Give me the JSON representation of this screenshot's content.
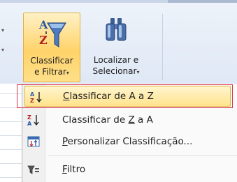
{
  "ribbon": {
    "sort_filter": {
      "line1": "Classificar",
      "line2": "e Filtrar",
      "caret": "▾",
      "icon": "sort-az-funnel-icon"
    },
    "find_select": {
      "line1": "Localizar e",
      "line2": "Selecionar",
      "caret": "▾",
      "icon": "binoculars-icon"
    }
  },
  "menu": {
    "items": [
      {
        "label_pre": "",
        "label_ul": "C",
        "label_post": "lassificar de A a Z",
        "icon": "sort-a-to-z-icon",
        "highlighted": true
      },
      {
        "label_pre": "Classificar de ",
        "label_ul": "Z",
        "label_post": " a A",
        "icon": "sort-z-to-a-icon",
        "highlighted": false
      },
      {
        "label_pre": "",
        "label_ul": "P",
        "label_post": "ersonalizar Classificação...",
        "icon": "custom-sort-icon",
        "highlighted": false
      },
      {
        "label_pre": "",
        "label_ul": "F",
        "label_post": "iltro",
        "icon": "filter-icon",
        "highlighted": false
      }
    ]
  },
  "colors": {
    "highlight_fill": "#ffe38c",
    "highlight_border": "#e5b43c",
    "callout_border": "#d9344a"
  }
}
